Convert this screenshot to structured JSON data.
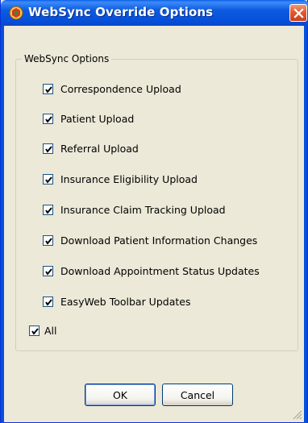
{
  "window": {
    "title": "WebSync Override Options"
  },
  "group": {
    "label": "WebSync Options",
    "options": [
      {
        "label": "Correspondence Upload",
        "checked": true
      },
      {
        "label": "Patient Upload",
        "checked": true
      },
      {
        "label": "Referral Upload",
        "checked": true
      },
      {
        "label": "Insurance Eligibility Upload",
        "checked": true
      },
      {
        "label": "Insurance Claim Tracking Upload",
        "checked": true
      },
      {
        "label": "Download Patient Information Changes",
        "checked": true
      },
      {
        "label": "Download Appointment Status Updates",
        "checked": true
      },
      {
        "label": "EasyWeb Toolbar Updates",
        "checked": true
      }
    ]
  },
  "all_option": {
    "label": "All",
    "checked": true
  },
  "buttons": {
    "ok_label": "OK",
    "cancel_label": "Cancel"
  },
  "icons": {
    "title": "app-icon",
    "close": "close-icon",
    "check": "check-icon",
    "grip": "resize-grip-icon"
  }
}
